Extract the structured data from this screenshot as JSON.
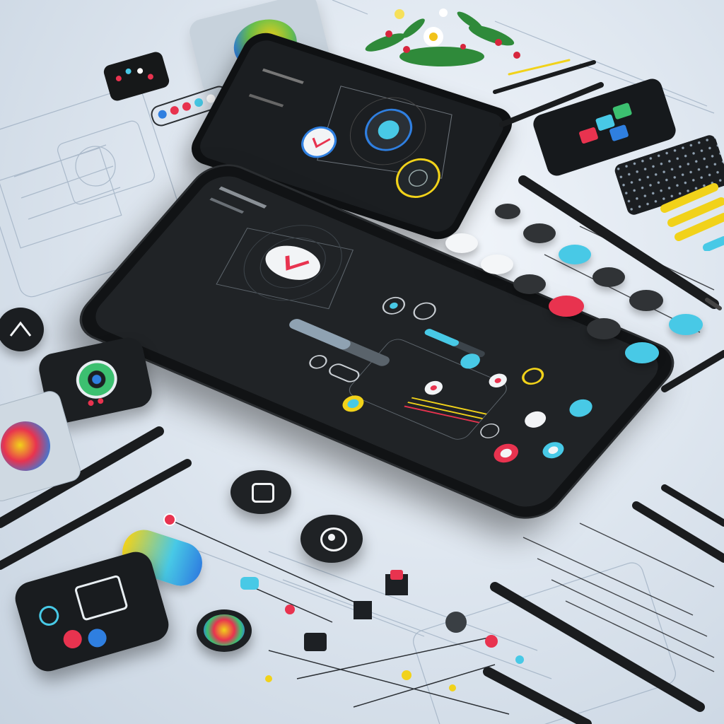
{
  "colors": {
    "background": "#dfe7f0",
    "phone_body": "#151719",
    "phone_screen": "#1f2225",
    "accent_red": "#e8334f",
    "accent_cyan": "#48c9e6",
    "accent_yellow": "#f1d21a",
    "accent_blue": "#2f7fe0",
    "accent_green": "#3cc070"
  },
  "front_phone": {
    "icons": [
      "heart-icon",
      "record-icon",
      "play-icon",
      "toggle-icon",
      "audio-icon"
    ],
    "buttons": [
      {
        "name": "cyan-button",
        "color": "#48c9e6"
      },
      {
        "name": "red-button",
        "color": "#e8334f"
      },
      {
        "name": "yellow-button",
        "color": "#f1d21a"
      },
      {
        "name": "white-button",
        "color": "#f2f4f6"
      }
    ],
    "slider_level": 0.6
  },
  "back_phone": {
    "icons": [
      "cloud-icon",
      "check-icon",
      "target-icon"
    ]
  },
  "side_buttons": [
    {
      "name": "round-button-1",
      "color": "#f4f6f8"
    },
    {
      "name": "round-button-2",
      "color": "#303336"
    },
    {
      "name": "round-button-3",
      "color": "#48c9e6"
    },
    {
      "name": "round-button-4",
      "color": "#e8334f"
    }
  ],
  "palette_tiles": [
    "#e8334f",
    "#48c9e6",
    "#3cc070",
    "#2f7fe0"
  ],
  "decor": {
    "pens": 6,
    "knobs": [
      "knob-icon-1",
      "knob-icon-2"
    ],
    "flowers": "flower-icon"
  }
}
